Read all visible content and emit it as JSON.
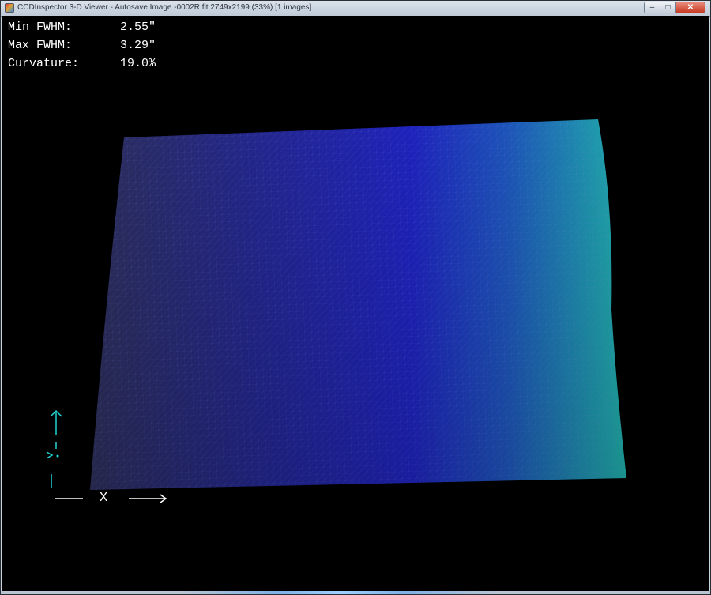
{
  "window": {
    "title": "CCDInspector 3-D Viewer - Autosave Image -0002R.fit 2749x2199 (33%)  [1 images]",
    "buttons": {
      "minimize": "–",
      "maximize": "□",
      "close": "✕"
    }
  },
  "stats": [
    {
      "label": "Min FWHM:",
      "value": "2.55\""
    },
    {
      "label": "Max FWHM:",
      "value": "3.29\""
    },
    {
      "label": "Curvature:",
      "value": "19.0%"
    }
  ],
  "axes": {
    "x_label": "X"
  },
  "colors": {
    "background": "#000000",
    "surface_left": "#2b2c5a",
    "surface_mid": "#1f22b8",
    "surface_right": "#1fa6a8",
    "axis_color": "#22d3d3",
    "grid": "#5a6ad0"
  },
  "icons": {
    "app": "ccdinspector-app-icon"
  }
}
